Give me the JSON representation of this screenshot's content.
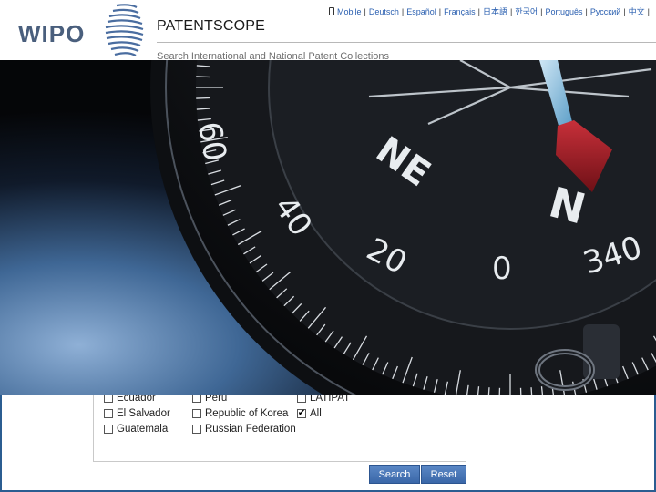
{
  "header": {
    "logo_text": "WIPO",
    "brand": "PATENTSCOPE",
    "subtitle": "Search International and National Patent Collections"
  },
  "langbar": {
    "items": [
      "Mobile",
      "Deutsch",
      "Español",
      "Français",
      "日本語",
      "한국어",
      "Português",
      "Русский",
      "中文"
    ]
  },
  "compass": {
    "labels": [
      "60",
      "40",
      "20",
      "0",
      "340",
      "NE",
      "N"
    ]
  },
  "offices": {
    "col1": [
      {
        "label": "Ecuador",
        "checked": false
      },
      {
        "label": "El Salvador",
        "checked": false
      },
      {
        "label": "Guatemala",
        "checked": false
      }
    ],
    "col2": [
      {
        "label": "Peru",
        "checked": false
      },
      {
        "label": "Republic of Korea",
        "checked": false
      },
      {
        "label": "Russian Federation",
        "checked": false
      }
    ],
    "col3": [
      {
        "label": "LATIPAT",
        "checked": false
      },
      {
        "label": "All",
        "checked": true
      }
    ]
  },
  "buttons": {
    "search": "Search",
    "reset": "Reset"
  }
}
